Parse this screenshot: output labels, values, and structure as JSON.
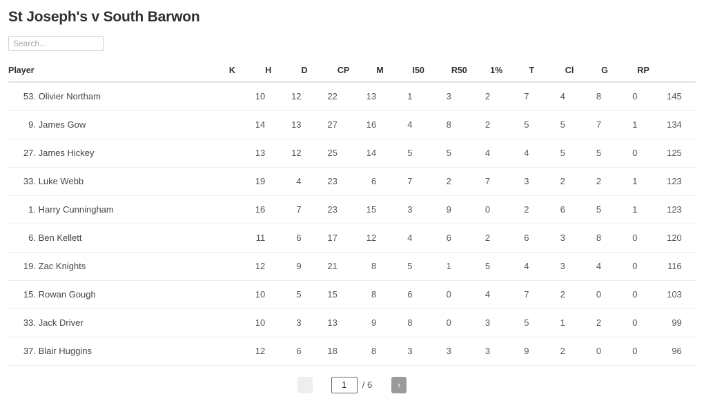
{
  "header": {
    "title": "St Joseph's v South Barwon"
  },
  "search": {
    "placeholder": "Search...",
    "value": ""
  },
  "table": {
    "columns": [
      "Player",
      "K",
      "H",
      "D",
      "CP",
      "M",
      "I50",
      "R50",
      "1%",
      "T",
      "Cl",
      "G",
      "RP"
    ],
    "rows": [
      {
        "number": "53.",
        "name": "Olivier Northam",
        "K": 10,
        "H": 12,
        "D": 22,
        "CP": 13,
        "M": 1,
        "I50": 3,
        "R50": 2,
        "onepct": 7,
        "T": 4,
        "Cl": 8,
        "G": 0,
        "RP": 145
      },
      {
        "number": "9.",
        "name": "James Gow",
        "K": 14,
        "H": 13,
        "D": 27,
        "CP": 16,
        "M": 4,
        "I50": 8,
        "R50": 2,
        "onepct": 5,
        "T": 5,
        "Cl": 7,
        "G": 1,
        "RP": 134
      },
      {
        "number": "27.",
        "name": "James Hickey",
        "K": 13,
        "H": 12,
        "D": 25,
        "CP": 14,
        "M": 5,
        "I50": 5,
        "R50": 4,
        "onepct": 4,
        "T": 5,
        "Cl": 5,
        "G": 0,
        "RP": 125
      },
      {
        "number": "33.",
        "name": "Luke Webb",
        "K": 19,
        "H": 4,
        "D": 23,
        "CP": 6,
        "M": 7,
        "I50": 2,
        "R50": 7,
        "onepct": 3,
        "T": 2,
        "Cl": 2,
        "G": 1,
        "RP": 123
      },
      {
        "number": "1.",
        "name": "Harry Cunningham",
        "K": 16,
        "H": 7,
        "D": 23,
        "CP": 15,
        "M": 3,
        "I50": 9,
        "R50": 0,
        "onepct": 2,
        "T": 6,
        "Cl": 5,
        "G": 1,
        "RP": 123
      },
      {
        "number": "6.",
        "name": "Ben Kellett",
        "K": 11,
        "H": 6,
        "D": 17,
        "CP": 12,
        "M": 4,
        "I50": 6,
        "R50": 2,
        "onepct": 6,
        "T": 3,
        "Cl": 8,
        "G": 0,
        "RP": 120
      },
      {
        "number": "19.",
        "name": "Zac Knights",
        "K": 12,
        "H": 9,
        "D": 21,
        "CP": 8,
        "M": 5,
        "I50": 1,
        "R50": 5,
        "onepct": 4,
        "T": 3,
        "Cl": 4,
        "G": 0,
        "RP": 116
      },
      {
        "number": "15.",
        "name": "Rowan Gough",
        "K": 10,
        "H": 5,
        "D": 15,
        "CP": 8,
        "M": 6,
        "I50": 0,
        "R50": 4,
        "onepct": 7,
        "T": 2,
        "Cl": 0,
        "G": 0,
        "RP": 103
      },
      {
        "number": "33.",
        "name": "Jack Driver",
        "K": 10,
        "H": 3,
        "D": 13,
        "CP": 9,
        "M": 8,
        "I50": 0,
        "R50": 3,
        "onepct": 5,
        "T": 1,
        "Cl": 2,
        "G": 0,
        "RP": 99
      },
      {
        "number": "37.",
        "name": "Blair Huggins",
        "K": 12,
        "H": 6,
        "D": 18,
        "CP": 8,
        "M": 3,
        "I50": 3,
        "R50": 3,
        "onepct": 9,
        "T": 2,
        "Cl": 0,
        "G": 0,
        "RP": 96
      }
    ]
  },
  "pagination": {
    "prev_label": "‹",
    "next_label": "›",
    "current_page": "1",
    "total_label": "/ 6",
    "total_pages": 6
  },
  "colors": {
    "text": "#333333",
    "muted": "#555555",
    "border": "#ededed",
    "header_border": "#e2e2e2",
    "next_button": "#9a9a9a",
    "prev_button": "#eeeeee"
  }
}
